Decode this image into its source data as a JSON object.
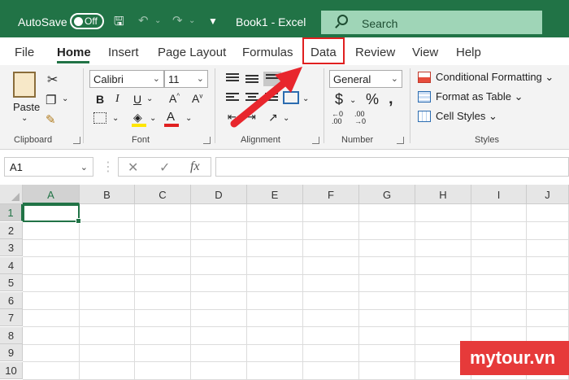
{
  "titlebar": {
    "autosave_label": "AutoSave",
    "autosave_state": "Off",
    "title": "Book1  -  Excel",
    "search_placeholder": "Search"
  },
  "tabs": [
    "File",
    "Home",
    "Insert",
    "Page Layout",
    "Formulas",
    "Data",
    "Review",
    "View",
    "Help"
  ],
  "active_tab": "Home",
  "highlighted_tab": "Data",
  "ribbon": {
    "clipboard": {
      "paste_label": "Paste",
      "group_label": "Clipboard"
    },
    "font": {
      "font_name": "Calibri",
      "font_size": "11",
      "group_label": "Font"
    },
    "alignment": {
      "group_label": "Alignment"
    },
    "number": {
      "format": "General",
      "group_label": "Number"
    },
    "styles": {
      "conditional_formatting": "Conditional Formatting",
      "format_as_table": "Format as Table",
      "cell_styles": "Cell Styles",
      "group_label": "Styles"
    }
  },
  "formula_bar": {
    "name_box": "A1",
    "fx_label": "fx",
    "value": ""
  },
  "grid": {
    "columns": [
      "A",
      "B",
      "C",
      "D",
      "E",
      "F",
      "G",
      "H",
      "I",
      "J"
    ],
    "rows": [
      "1",
      "2",
      "3",
      "4",
      "5",
      "6",
      "7",
      "8",
      "9",
      "10"
    ],
    "active_cell": "A1"
  },
  "colors": {
    "excel_green": "#217346",
    "highlight_red": "#e02020",
    "arrow_red": "#e8262d"
  },
  "watermark": "mytour.vn"
}
